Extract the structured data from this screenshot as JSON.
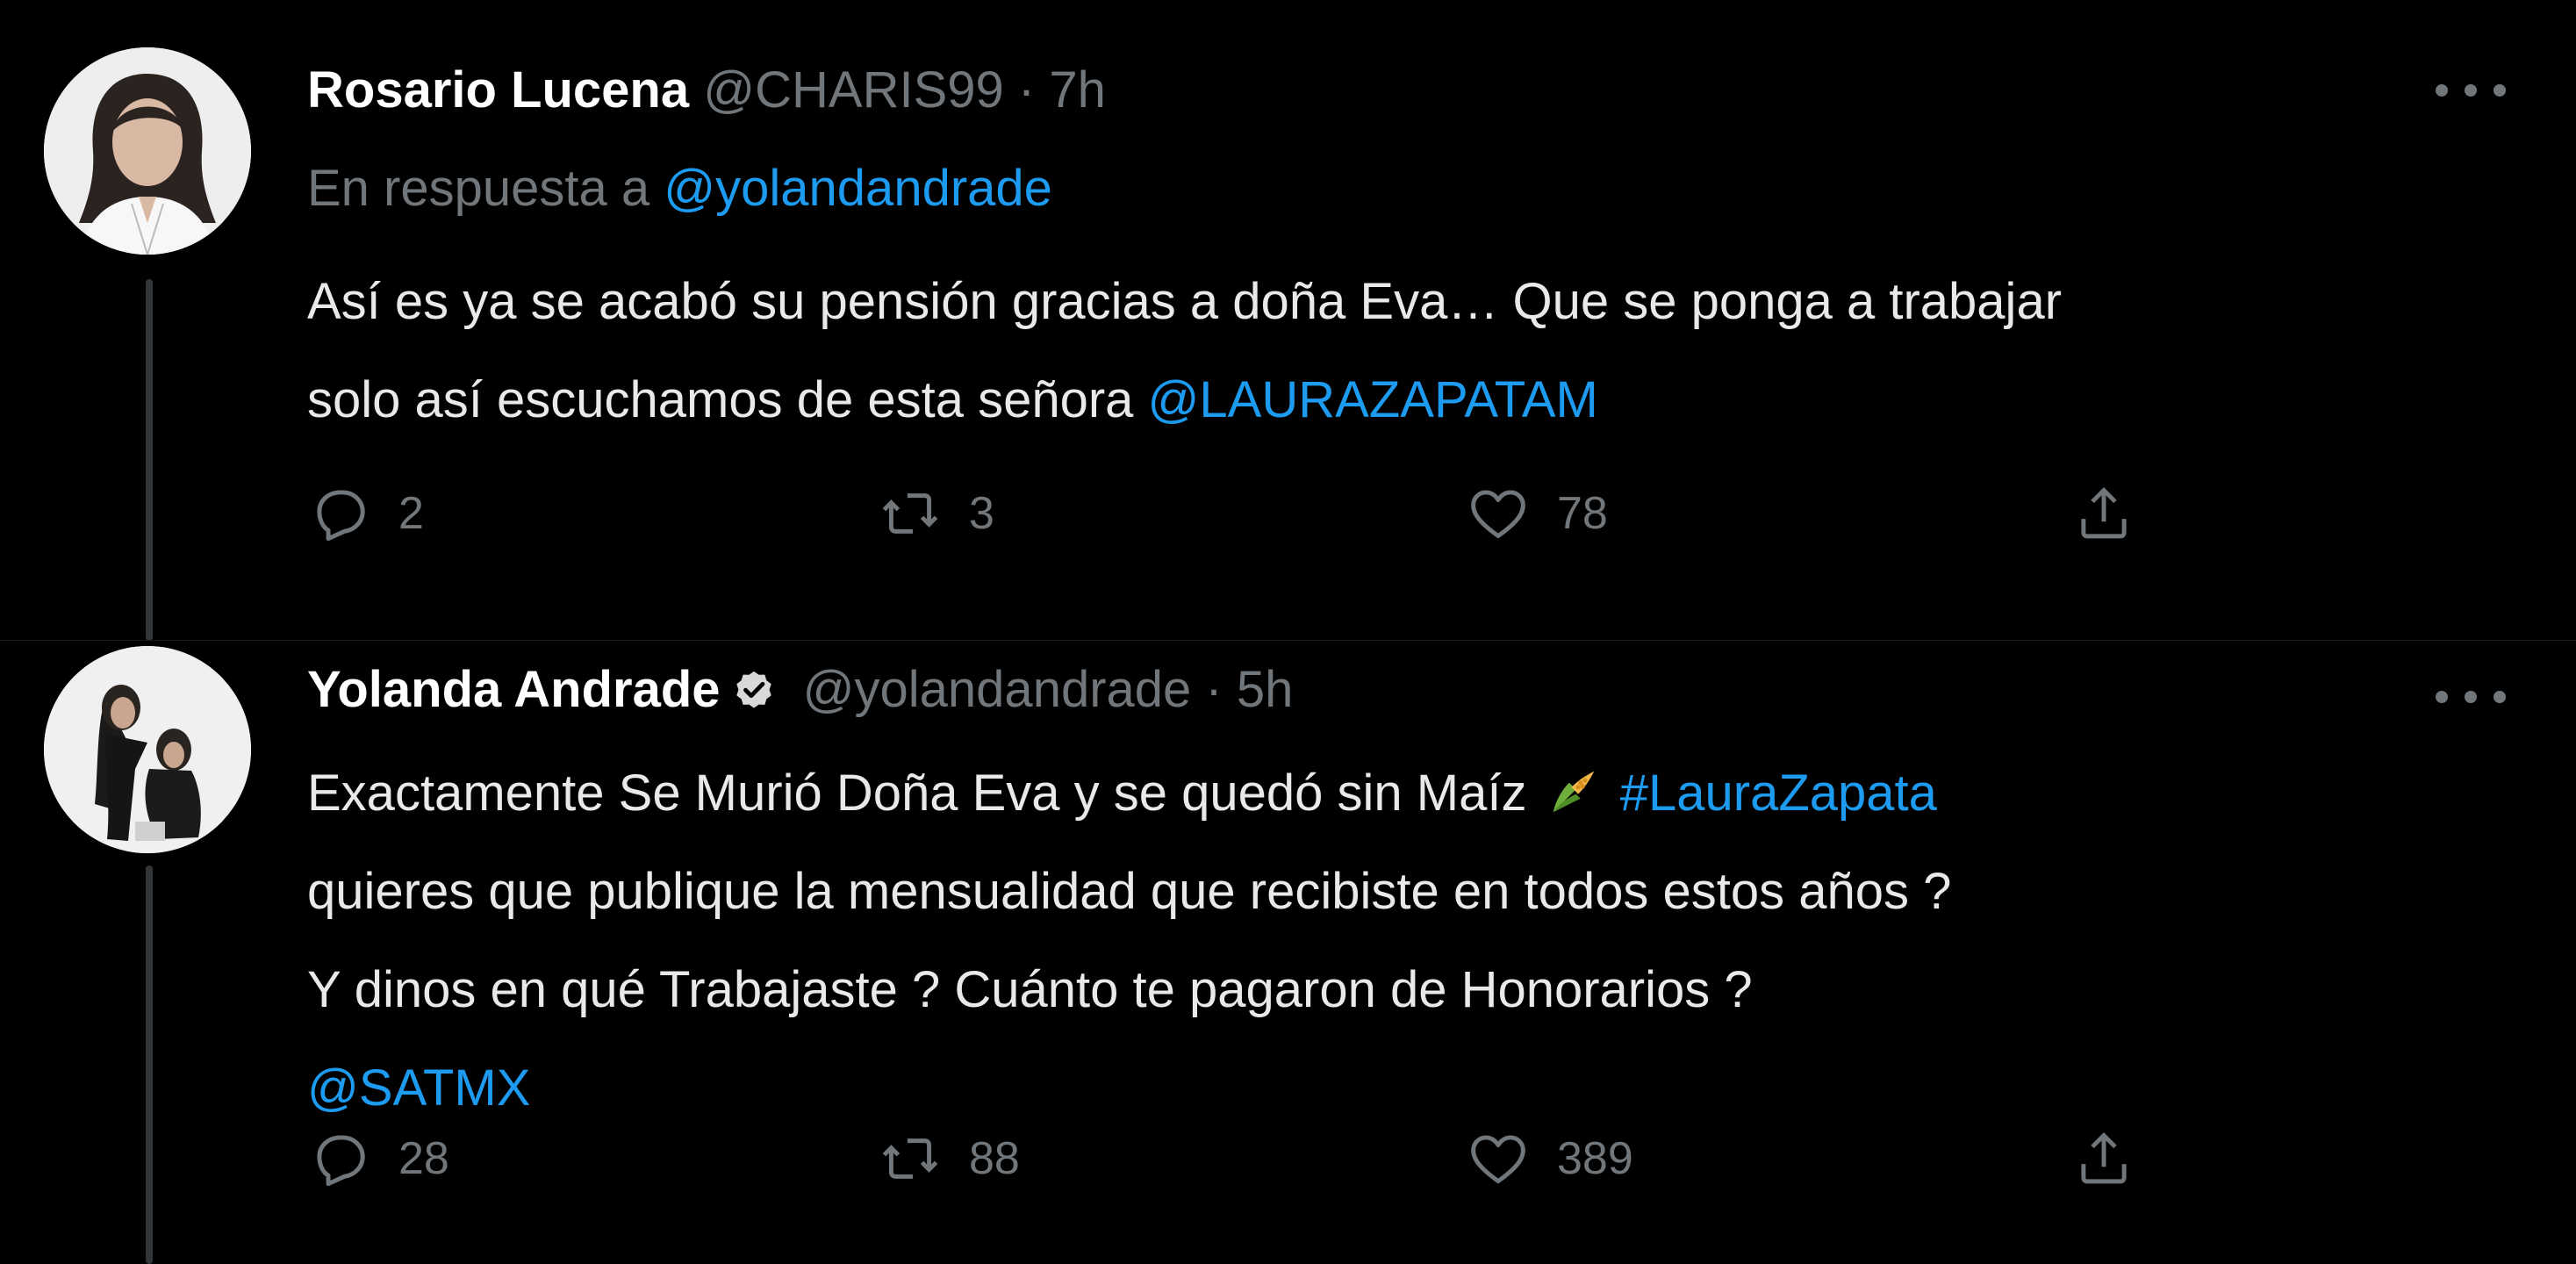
{
  "colors": {
    "background": "#000000",
    "text_primary": "#e7e9ea",
    "text_secondary": "#71767b",
    "link": "#1d9bf0",
    "verified_badge": "#d9d9d9"
  },
  "tweets": [
    {
      "author_name": "Rosario Lucena",
      "handle": "@CHARIS99",
      "separator": "·",
      "time": "7h",
      "verified": false,
      "reply_prefix": "En respuesta a",
      "reply_to": "@yolandandrade",
      "text_line_1": "Así es ya se acabó su pensión gracias a doña Eva… Que se ponga a trabajar",
      "text_line_2_plain": "solo así escuchamos de esta señora ",
      "text_line_2_mention": "@LAURAZAPATAM",
      "avatar_icon": "profile-photo",
      "actions": {
        "reply_count": "2",
        "retweet_count": "3",
        "like_count": "78",
        "reply_icon": "reply-icon",
        "retweet_icon": "retweet-icon",
        "like_icon": "heart-icon",
        "share_icon": "share-icon"
      }
    },
    {
      "author_name": "Yolanda Andrade",
      "handle": "@yolandandrade",
      "separator": "·",
      "time": "5h",
      "verified": true,
      "text_line_1_plain": "Exactamente Se Murió Doña Eva y se quedó sin Maíz",
      "text_line_1_emoji": "corn-emoji",
      "text_line_1_hashtag": "#LauraZapata",
      "text_line_2": "quieres que publique la mensualidad que recibiste en todos estos años ?",
      "text_line_3": "Y dinos en qué Trabajaste ? Cuánto te pagaron de Honorarios ?",
      "text_line_4_mention": "@SATMX",
      "avatar_icon": "profile-photo",
      "actions": {
        "reply_count": "28",
        "retweet_count": "88",
        "like_count": "389",
        "reply_icon": "reply-icon",
        "retweet_icon": "retweet-icon",
        "like_icon": "heart-icon",
        "share_icon": "share-icon"
      }
    }
  ]
}
